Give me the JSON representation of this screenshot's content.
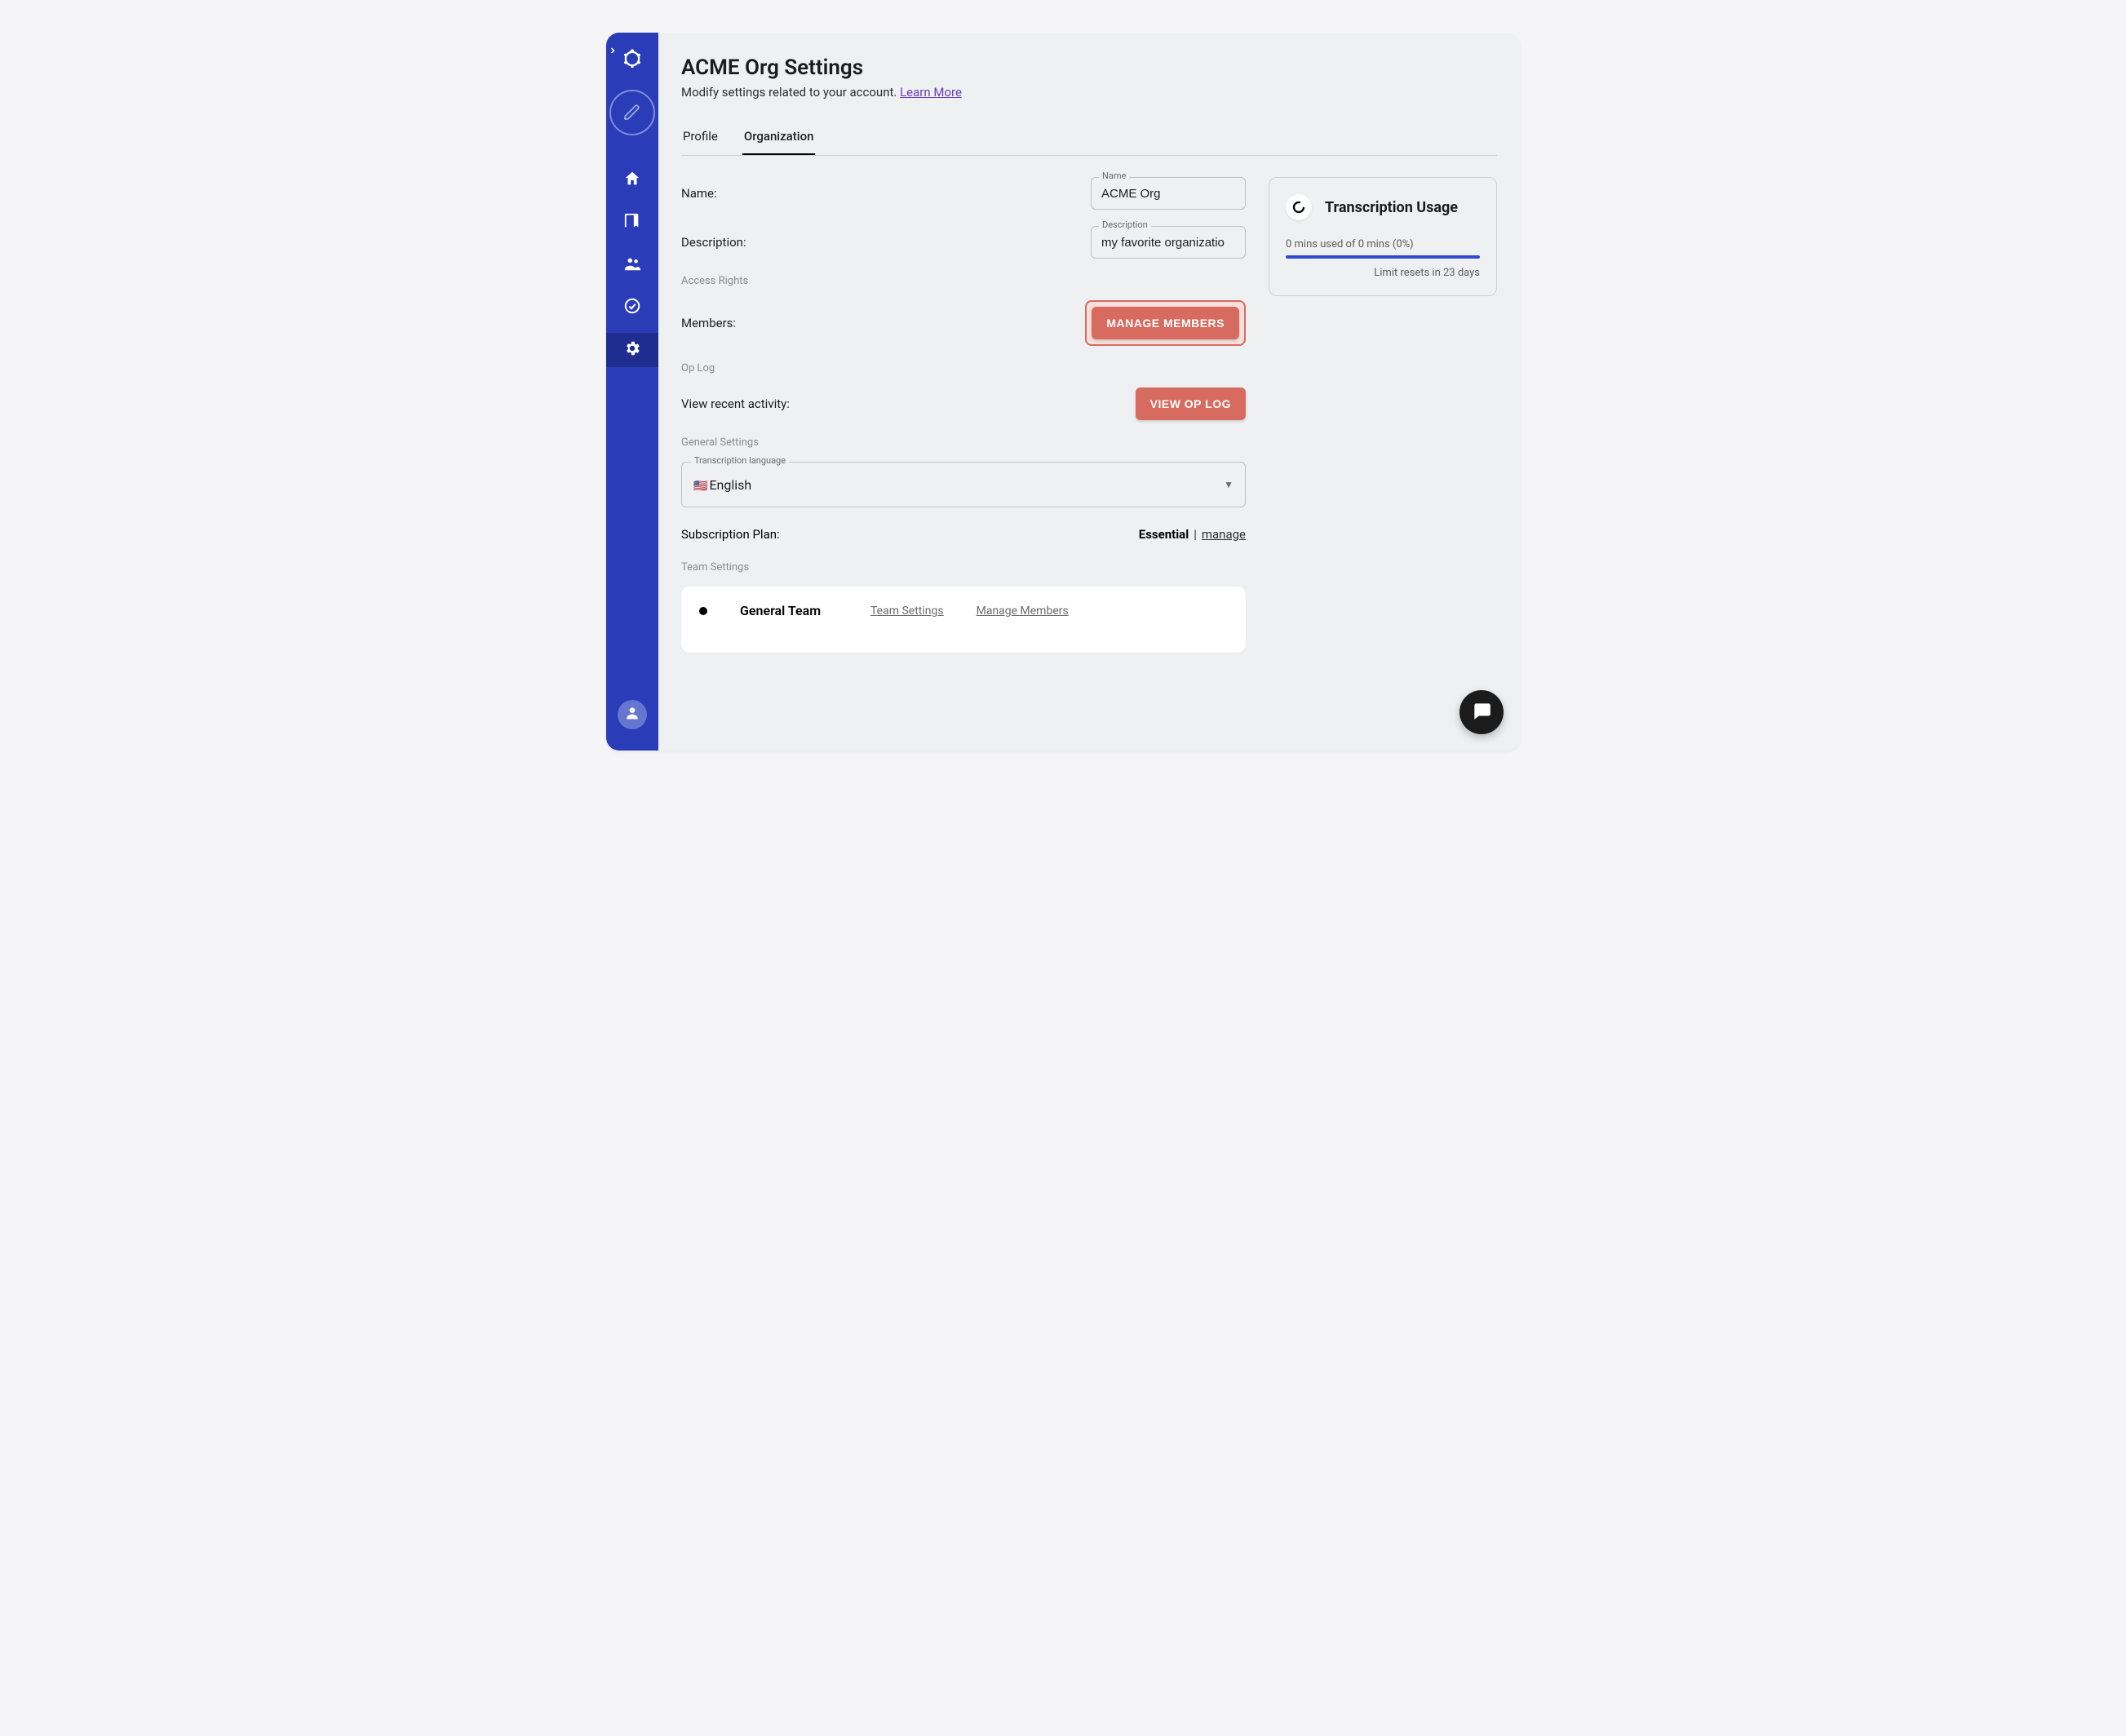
{
  "page": {
    "title": "ACME Org Settings",
    "subtitle": "Modify settings related to your account.",
    "learn_more": "Learn More"
  },
  "tabs": [
    {
      "label": "Profile",
      "active": false
    },
    {
      "label": "Organization",
      "active": true
    }
  ],
  "org": {
    "name_label": "Name:",
    "name_float": "Name",
    "name_value": "ACME Org",
    "desc_label": "Description:",
    "desc_float": "Description",
    "desc_value": "my favorite organizatio"
  },
  "sections": {
    "access": "Access Rights",
    "oplog": "Op Log",
    "general": "General Settings",
    "teams": "Team Settings"
  },
  "members": {
    "label": "Members:",
    "button": "MANAGE MEMBERS"
  },
  "oplog": {
    "label": "View recent activity:",
    "button": "VIEW OP LOG"
  },
  "language": {
    "float": "Transcription language",
    "flag": "🇺🇸",
    "value": "English"
  },
  "subscription": {
    "label": "Subscription Plan:",
    "plan": "Essential",
    "divider": "|",
    "manage": "manage"
  },
  "teams": [
    {
      "name": "General Team",
      "settings": "Team Settings",
      "manage": "Manage Members"
    }
  ],
  "usage": {
    "title": "Transcription Usage",
    "text": "0 mins used of 0 mins (0%)",
    "reset": "Limit resets in 23 days"
  }
}
